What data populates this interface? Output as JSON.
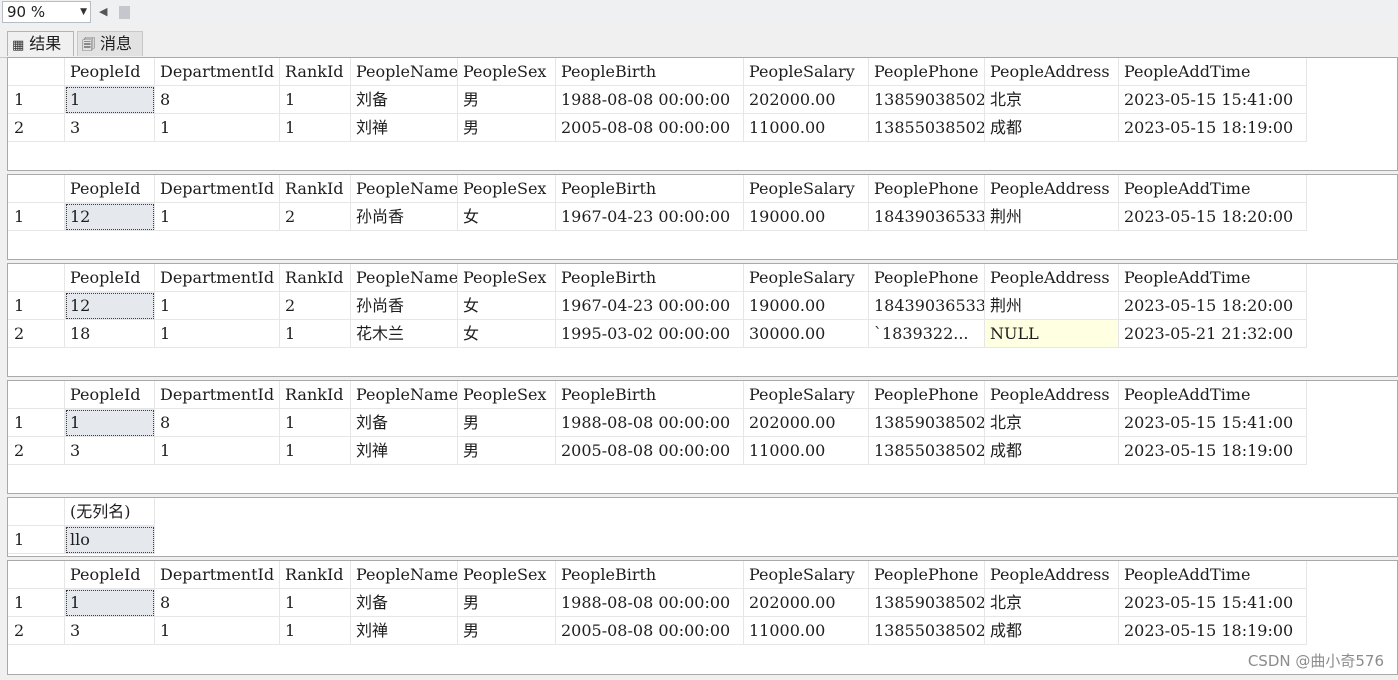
{
  "toolbar": {
    "zoom": "90 %"
  },
  "tabs": [
    {
      "label": "结果",
      "icon": "grid-icon"
    },
    {
      "label": "消息",
      "icon": "messages-icon"
    }
  ],
  "result_grids": [
    {
      "columns": [
        "PeopleId",
        "DepartmentId",
        "RankId",
        "PeopleName",
        "PeopleSex",
        "PeopleBirth",
        "PeopleSalary",
        "PeoplePhone",
        "PeopleAddress",
        "PeopleAddTime"
      ],
      "rows": [
        [
          "1",
          "1",
          "8",
          "1",
          "刘备",
          "男",
          "1988-08-08 00:00:00",
          "202000.00",
          "13859038502",
          "北京",
          "2023-05-15 15:41:00"
        ],
        [
          "2",
          "3",
          "1",
          "1",
          "刘禅",
          "男",
          "2005-08-08 00:00:00",
          "11000.00",
          "13855038502",
          "成都",
          "2023-05-15 18:19:00"
        ]
      ]
    },
    {
      "columns": [
        "PeopleId",
        "DepartmentId",
        "RankId",
        "PeopleName",
        "PeopleSex",
        "PeopleBirth",
        "PeopleSalary",
        "PeoplePhone",
        "PeopleAddress",
        "PeopleAddTime"
      ],
      "rows": [
        [
          "1",
          "12",
          "1",
          "2",
          "孙尚香",
          "女",
          "1967-04-23 00:00:00",
          "19000.00",
          "18439036533",
          "荆州",
          "2023-05-15 18:20:00"
        ]
      ]
    },
    {
      "columns": [
        "PeopleId",
        "DepartmentId",
        "RankId",
        "PeopleName",
        "PeopleSex",
        "PeopleBirth",
        "PeopleSalary",
        "PeoplePhone",
        "PeopleAddress",
        "PeopleAddTime"
      ],
      "rows": [
        [
          "1",
          "12",
          "1",
          "2",
          "孙尚香",
          "女",
          "1967-04-23 00:00:00",
          "19000.00",
          "18439036533",
          "荆州",
          "2023-05-15 18:20:00"
        ],
        [
          "2",
          "18",
          "1",
          "1",
          "花木兰",
          "女",
          "1995-03-02 00:00:00",
          "30000.00",
          "`1839322...",
          "NULL",
          "2023-05-21 21:32:00"
        ]
      ]
    },
    {
      "columns": [
        "PeopleId",
        "DepartmentId",
        "RankId",
        "PeopleName",
        "PeopleSex",
        "PeopleBirth",
        "PeopleSalary",
        "PeoplePhone",
        "PeopleAddress",
        "PeopleAddTime"
      ],
      "rows": [
        [
          "1",
          "1",
          "8",
          "1",
          "刘备",
          "男",
          "1988-08-08 00:00:00",
          "202000.00",
          "13859038502",
          "北京",
          "2023-05-15 15:41:00"
        ],
        [
          "2",
          "3",
          "1",
          "1",
          "刘禅",
          "男",
          "2005-08-08 00:00:00",
          "11000.00",
          "13855038502",
          "成都",
          "2023-05-15 18:19:00"
        ]
      ]
    },
    {
      "columns": [
        "(无列名)"
      ],
      "rows": [
        [
          "1",
          "llo"
        ]
      ]
    },
    {
      "columns": [
        "PeopleId",
        "DepartmentId",
        "RankId",
        "PeopleName",
        "PeopleSex",
        "PeopleBirth",
        "PeopleSalary",
        "PeoplePhone",
        "PeopleAddress",
        "PeopleAddTime"
      ],
      "rows": [
        [
          "1",
          "1",
          "8",
          "1",
          "刘备",
          "男",
          "1988-08-08 00:00:00",
          "202000.00",
          "13859038502",
          "北京",
          "2023-05-15 15:41:00"
        ],
        [
          "2",
          "3",
          "1",
          "1",
          "刘禅",
          "男",
          "2005-08-08 00:00:00",
          "11000.00",
          "13855038502",
          "成都",
          "2023-05-15 18:19:00"
        ]
      ]
    }
  ],
  "watermark": "CSDN @曲小奇576"
}
